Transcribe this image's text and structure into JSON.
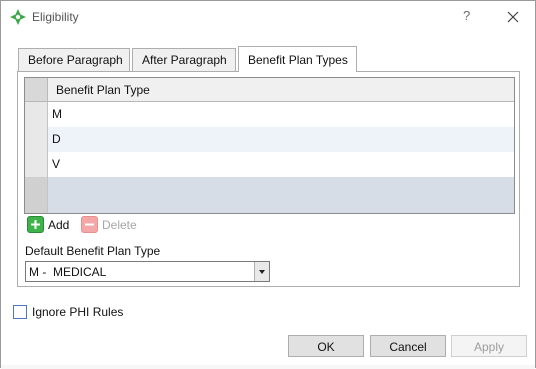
{
  "window": {
    "title": "Eligibility",
    "help_label": "?",
    "icons": {
      "app": "green-diamond-icon",
      "close": "close-icon"
    }
  },
  "tabs": [
    {
      "label": "Before Paragraph",
      "active": false
    },
    {
      "label": "After Paragraph",
      "active": false
    },
    {
      "label": "Benefit Plan Types",
      "active": true
    }
  ],
  "grid": {
    "column_header": "Benefit Plan Type",
    "rows": [
      {
        "value": "M"
      },
      {
        "value": "D"
      },
      {
        "value": "V"
      }
    ]
  },
  "toolbar": {
    "add_label": "Add",
    "delete_label": "Delete",
    "icons": {
      "add": "plus-icon",
      "delete": "minus-icon"
    }
  },
  "default_plan": {
    "label": "Default Benefit Plan Type",
    "selected_value": "M -  MEDICAL",
    "icons": {
      "dropdown": "chevron-down-icon"
    }
  },
  "options": {
    "ignore_phi_label": "Ignore PHI Rules",
    "ignore_phi_checked": false
  },
  "buttons": {
    "ok": "OK",
    "cancel": "Cancel",
    "apply": "Apply"
  },
  "colors": {
    "accent_green": "#3db34a",
    "selection_blue": "#d6dde7",
    "checkbox_border": "#4a78c2"
  }
}
